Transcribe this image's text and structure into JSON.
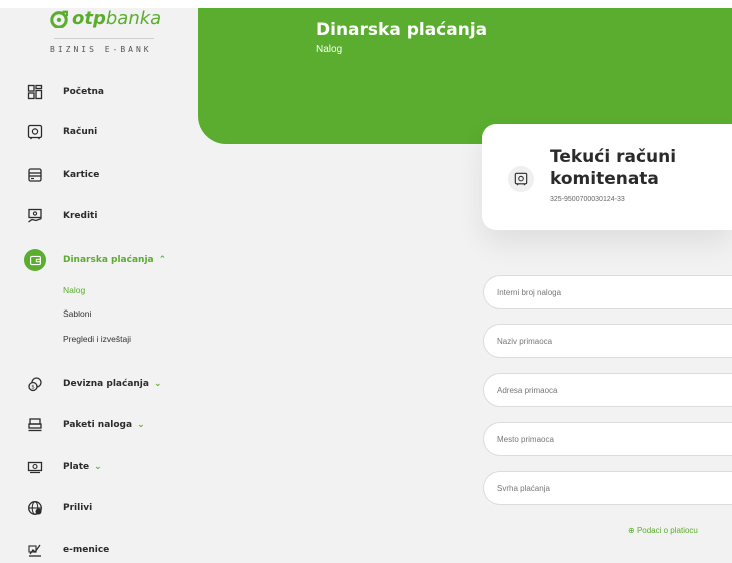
{
  "brand": {
    "logo_bold": "otp",
    "logo_light": "banka",
    "subtitle": "BIZNIS E-BANK",
    "accent_color": "#5aad2e"
  },
  "header": {
    "title": "Dinarska plaćanja",
    "subtitle": "Nalog"
  },
  "sidebar": {
    "items": [
      {
        "label": "Početna",
        "icon": "dashboard-icon"
      },
      {
        "label": "Računi",
        "icon": "safe-icon"
      },
      {
        "label": "Kartice",
        "icon": "card-icon"
      },
      {
        "label": "Krediti",
        "icon": "loan-icon"
      },
      {
        "label": "Dinarska plaćanja",
        "icon": "wallet-icon",
        "chevron": "^",
        "active": true
      },
      {
        "label": "Devizna plaćanja",
        "icon": "coins-icon",
        "chevron": "v"
      },
      {
        "label": "Paketi naloga",
        "icon": "stack-icon",
        "chevron": "v"
      },
      {
        "label": "Plate",
        "icon": "cash-icon",
        "chevron": "v"
      },
      {
        "label": "Prilivi",
        "icon": "globe-money-icon"
      },
      {
        "label": "e-menice",
        "icon": "sign-icon"
      }
    ],
    "subitems": [
      {
        "label": "Nalog",
        "active": true
      },
      {
        "label": "Šabloni"
      },
      {
        "label": "Pregledi i izveštaji"
      }
    ]
  },
  "account_card": {
    "title_line1": "Tekući računi",
    "title_line2": "komitenata",
    "account_number": "325-9500700030124-33"
  },
  "form": {
    "fields": [
      {
        "placeholder": "Interni broj naloga"
      },
      {
        "placeholder": "Naziv primaoca"
      },
      {
        "placeholder": "Adresa primaoca"
      },
      {
        "placeholder": "Mesto primaoca"
      },
      {
        "placeholder": "Svrha plaćanja"
      }
    ],
    "payer_link": "Podaci o platiocu",
    "payer_link_icon": "plus-circle-icon"
  }
}
